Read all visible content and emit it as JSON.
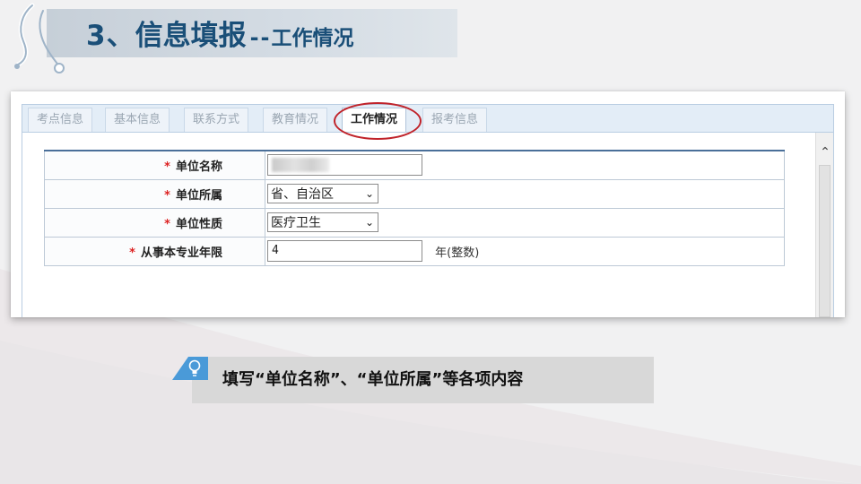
{
  "header": {
    "number": "3、",
    "title": "信息填报",
    "separator": "--",
    "subtitle": "工作情况"
  },
  "tabs": [
    {
      "label": "考点信息",
      "active": false
    },
    {
      "label": "基本信息",
      "active": false
    },
    {
      "label": "联系方式",
      "active": false
    },
    {
      "label": "教育情况",
      "active": false
    },
    {
      "label": "工作情况",
      "active": true
    },
    {
      "label": "报考信息",
      "active": false
    }
  ],
  "form": {
    "required_mark": "*",
    "rows": [
      {
        "label": "单位名称",
        "type": "text",
        "value": ""
      },
      {
        "label": "单位所属",
        "type": "select",
        "value": "省、自治区"
      },
      {
        "label": "单位性质",
        "type": "select",
        "value": "医疗卫生"
      },
      {
        "label": "从事本专业年限",
        "type": "text",
        "value": "4",
        "suffix": "年(整数)"
      }
    ]
  },
  "caption": {
    "text": "填写“单位名称”、“单位所属”等各项内容"
  },
  "icons": {
    "scroll_up": "chevron-up-icon",
    "select_arrow": "chevron-down-icon",
    "bulb": "lightbulb-icon",
    "stethoscope": "stethoscope-icon"
  },
  "colors": {
    "title": "#1a4f78",
    "required": "#dd2222",
    "highlight_ring": "#c0232a",
    "caption_accent": "#4a9ad8"
  }
}
